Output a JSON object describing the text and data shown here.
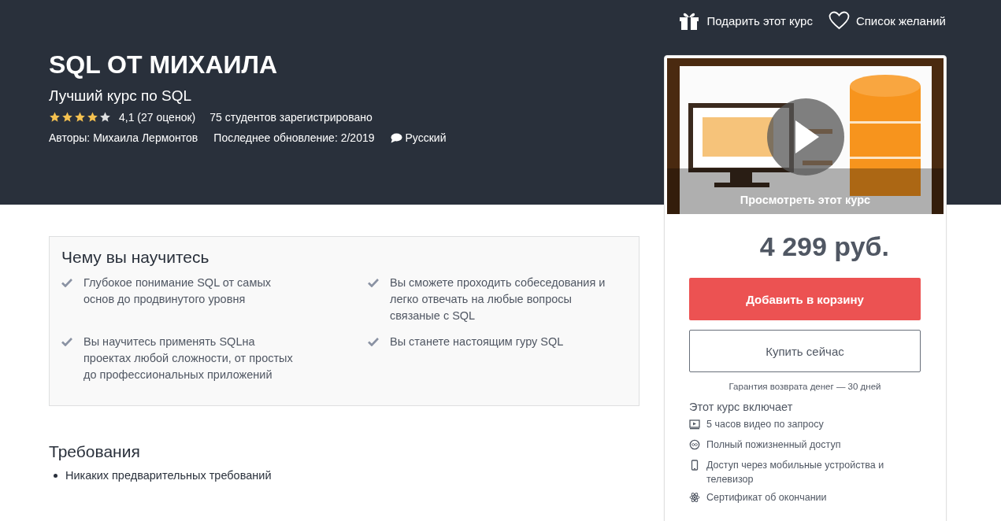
{
  "top_links": [
    {
      "kind": "gift",
      "label": "Подарить этот курс"
    },
    {
      "kind": "heart",
      "label": "Список желаний"
    }
  ],
  "course": {
    "title": "SQL ОТ МИХАИЛА",
    "subtitle": "Лучший курс по SQL",
    "stars": 4,
    "rating": "4,1 (27 оценок)",
    "students": "75 студентов зарегистрировано",
    "authors_label": "Авторы:",
    "author": "Михаила Лермонтов",
    "updated": "Последнее обновление: 2/2019",
    "language": "Русский"
  },
  "learn": {
    "title": "Чему вы научитесь",
    "items": [
      "Глубокое понимание SQL от самых основ до продвинутого уровня",
      "Вы сможете проходить собеседования и легко отвечать на любые вопросы связаные с SQL",
      "Вы научитесь применять SQLна проектах любой сложности, от простых до профессиональных приложений",
      "Вы станете настоящим гуру SQL"
    ]
  },
  "requirements": {
    "title": "Требования",
    "items": [
      "Никаких предварительных требований"
    ]
  },
  "sidebar": {
    "preview": {
      "kind": "picture",
      "caption": "Просмотреть этот курс"
    },
    "price": "4 299 руб.",
    "add_to_cart": "Добавить в корзину",
    "buy_now": "Купить сейчас",
    "guarantee": "Гарантия возврата денег — 30 дней",
    "includes_title": "Этот курс включает",
    "includes": [
      {
        "kind": "video",
        "text": "5 часов видео по запросу"
      },
      {
        "kind": "infinity",
        "text": "Полный пожизненный доступ"
      },
      {
        "kind": "mobile",
        "text": "Доступ через мобильные устройства и телевизор"
      },
      {
        "kind": "certificate",
        "text": "Сертификат об окончании"
      }
    ]
  }
}
